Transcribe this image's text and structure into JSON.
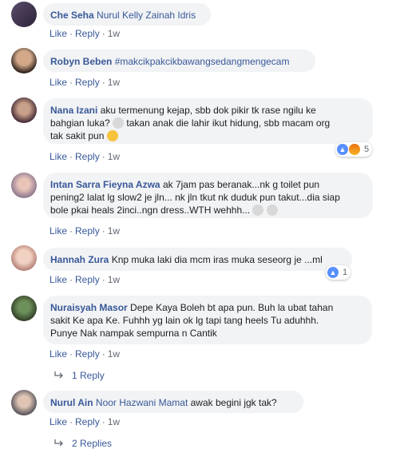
{
  "comments": [
    {
      "author": "Che Seha",
      "mentions": "Nurul Kelly Zainah Idris",
      "text": "",
      "actions": {
        "like": "Like",
        "reply": "Reply",
        "time": "1w"
      }
    },
    {
      "author": "Robyn Beben",
      "hashtag": "#makcikpakcikbawangsedangmengecam",
      "actions": {
        "like": "Like",
        "reply": "Reply",
        "time": "1w"
      }
    },
    {
      "author": "Nana Izani",
      "line1": "aku termenung kejap, sbb dok pikir tk rase ngilu ke",
      "line2a": "bahgian luka?",
      "line2b": "takan anak die lahir ikut hidung, sbb macam org",
      "line3": "tak sakit pun",
      "reaction_count": "5",
      "actions": {
        "like": "Like",
        "reply": "Reply",
        "time": "1w"
      }
    },
    {
      "author": "Intan Sarra Fieyna Azwa",
      "line1": "ak 7jam pas beranak...nk g toilet pun",
      "line2": "pening2 lalat lg slow2 je jln... nk jln tkut nk duduk pun takut...dia siap",
      "line3": "bole pkai heals 2inci..ngn dress..WTH wehhh...",
      "actions": {
        "like": "Like",
        "reply": "Reply",
        "time": "1w"
      }
    },
    {
      "author": "Hannah Zura",
      "text": "Knp muka laki dia mcm iras muka seseorg je ...ml",
      "reaction_count": "1",
      "actions": {
        "like": "Like",
        "reply": "Reply",
        "time": "1w"
      }
    },
    {
      "author": "Nuraisyah Masor",
      "line1": "Depe Kaya Boleh bt apa pun. Buh la ubat tahan",
      "line2": "sakit Ke apa Ke. Fuhhh yg lain ok lg tapi tang heels Tu aduhhh.",
      "line3": "Punye Nak nampak sempurna n Cantik",
      "actions": {
        "like": "Like",
        "reply": "Reply",
        "time": "1w"
      },
      "replies": "1 Reply"
    },
    {
      "author": "Nurul Ain",
      "mentions": "Noor Hazwani Mamat",
      "text": "awak begini jgk tak?",
      "actions": {
        "like": "Like",
        "reply": "Reply",
        "time": "1w"
      },
      "replies": "2 Replies"
    }
  ],
  "colors": {
    "link": "#385898",
    "bubble": "#f2f3f5",
    "meta": "#606770"
  }
}
